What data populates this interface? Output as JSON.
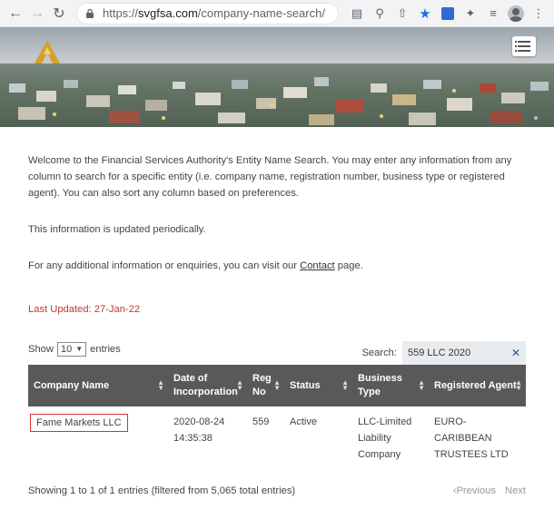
{
  "browser": {
    "url_scheme": "https://",
    "url_host": "svgfsa.com",
    "url_path": "/company-name-search/"
  },
  "intro": {
    "p1": "Welcome to the Financial Services Authority's Entity Name Search. You may enter any information from any column to search for a specific entity (i.e. company name, registration number, business type or registered agent). You can also sort any column based on preferences.",
    "p2": "This information is updated periodically.",
    "p3_prefix": "For any additional information or enquiries, you can visit our ",
    "p3_link": "Contact",
    "p3_suffix": " page.",
    "updated": "Last Updated:  27-Jan-22"
  },
  "controls": {
    "show_label": "Show",
    "entries_value": "10",
    "entries_label": "entries",
    "search_label": "Search:",
    "search_value": "559 LLC 2020"
  },
  "table": {
    "headers": [
      "Company Name",
      "Date of Incorporation",
      "Reg No",
      "Status",
      "Business Type",
      "Registered Agent"
    ],
    "rows": [
      {
        "company": "Fame Markets LLC",
        "date": "2020-08-24 14:35:38",
        "reg": "559",
        "status": "Active",
        "type": "LLC-Limited Liability Company",
        "agent": "EURO-CARIBBEAN TRUSTEES LTD"
      }
    ]
  },
  "footer": {
    "info": "Showing 1 to 1 of 1 entries (filtered from 5,065 total entries)",
    "prev": "Previous",
    "next": "Next"
  },
  "colors": {
    "header_bg": "#595959",
    "accent_red": "#c0392b",
    "highlight_border": "#d93030"
  }
}
